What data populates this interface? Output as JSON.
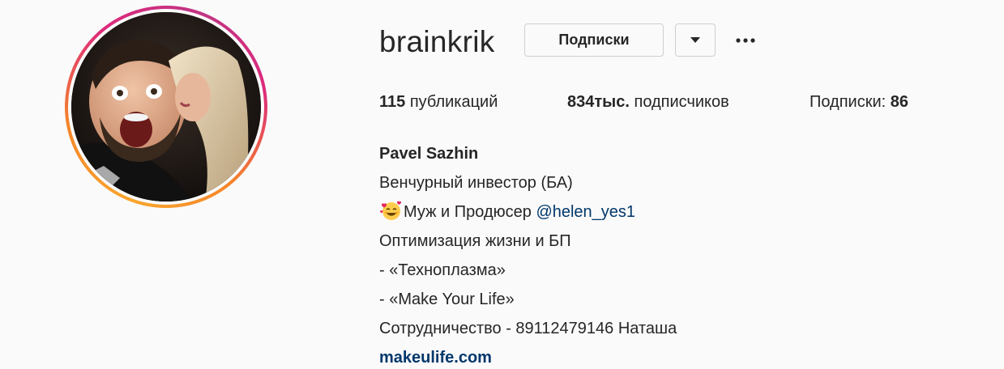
{
  "profile": {
    "username": "brainkrik",
    "follow_button_label": "Подписки",
    "dropdown_icon": "caret-down-icon",
    "more_icon": "more-horizontal-icon"
  },
  "stats": {
    "posts_count": "115",
    "posts_label": "публикаций",
    "followers_count": "834тыс.",
    "followers_label": "подписчиков",
    "following_label": "Подписки:",
    "following_count": "86"
  },
  "bio": {
    "name": "Pavel Sazhin",
    "line1": "Венчурный инвестор (БА)",
    "line2_text": "Муж и Продюсер ",
    "line2_emoji": "smiling-face-with-hearts-icon",
    "line2_mention": "@helen_yes1",
    "line3": "Оптимизация жизни и БП",
    "line4": "- «Техноплазма»",
    "line5": "- «Make Your Life»",
    "line6": "Сотрудничество - 89112479146 Наташа",
    "website": "makeulife.com"
  },
  "colors": {
    "background": "#fafafa",
    "text": "#262626",
    "link": "#00376b",
    "ring_start": "#f58529",
    "ring_end": "#dd2a7b"
  }
}
